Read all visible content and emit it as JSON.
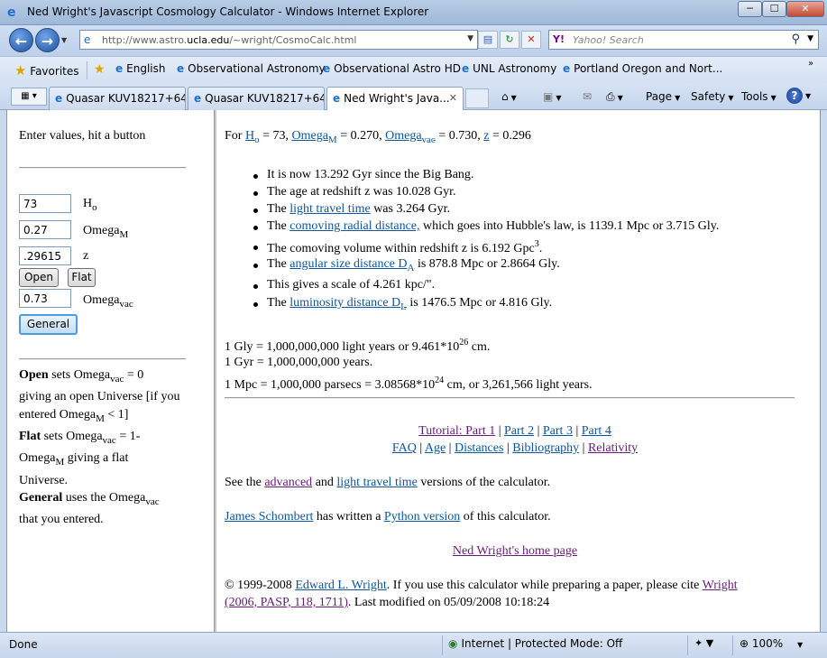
{
  "window": {
    "title": "Ned Wright's Javascript Cosmology Calculator - Windows Internet Explorer",
    "minimize": "─",
    "maximize": "☐",
    "close": "✕"
  },
  "address_bar": {
    "url_prefix": "http://www.astro.",
    "url_domain": "ucla.edu",
    "url_suffix": "/~wright/CosmoCalc.html"
  },
  "search": {
    "placeholder": "Yahoo! Search",
    "provider_icon": "Y!"
  },
  "favorites_bar": {
    "favorites_label": "Favorites",
    "items": [
      "English",
      "Observational Astronomy",
      "Observational Astro HD",
      "UNL Astronomy",
      "Portland Oregon and Nort..."
    ]
  },
  "tabs": [
    {
      "label": "Quasar KUV18217+64..."
    },
    {
      "label": "Quasar KUV18217+64..."
    },
    {
      "label": "Ned Wright's Java..."
    }
  ],
  "command_bar": {
    "page": "Page",
    "safety": "Safety",
    "tools": "Tools",
    "help": "?"
  },
  "left_frame": {
    "intro": "Enter values, hit a button",
    "inputs": {
      "h0_value": "73",
      "h0_label": "H",
      "h0_sub": "o",
      "omegam_value": "0.27",
      "omegam_label": "Omega",
      "omegam_sub": "M",
      "z_value": ".29615",
      "z_label": "z",
      "omegavac_value": "0.73",
      "omegavac_label": "Omega",
      "omegavac_sub": "vac"
    },
    "buttons": {
      "open": "Open",
      "flat": "Flat",
      "general": "General"
    },
    "help": {
      "open_bold": "Open",
      "open_t1": " sets Omega",
      "open_sub1": "vac",
      "open_t2": " = 0",
      "open_t3": "giving an open Universe [if you",
      "open_t4": "entered Omega",
      "open_sub2": "M",
      "open_t5": " < 1]",
      "flat_bold": "Flat",
      "flat_t1": " sets Omega",
      "flat_sub1": "vac",
      "flat_t2": " = 1-",
      "flat_t3": "Omega",
      "flat_sub2": "M",
      "flat_t4": " giving a flat",
      "flat_t5": "Universe.",
      "general_bold": "General",
      "general_t1": " uses the Omega",
      "general_sub": "vac",
      "general_t2": "that you entered."
    }
  },
  "right_frame": {
    "summary": {
      "for": "For ",
      "h0": "H",
      "h0_sub": "o",
      "h0_val": " = 73, ",
      "om": "Omega",
      "om_sub": "M",
      "om_val": " = 0.270, ",
      "ov": "Omega",
      "ov_sub": "vac",
      "ov_val": " = 0.730, ",
      "z": "z",
      "z_val": " = 0.296"
    },
    "results": {
      "r1": "It is now 13.292 Gyr since the Big Bang.",
      "r2": "The age at redshift z was 10.028 Gyr.",
      "r3_pre": "The ",
      "r3_link": "light travel time",
      "r3_post": " was 3.264 Gyr.",
      "r4_pre": "The ",
      "r4_link": "comoving radial distance,",
      "r4_post": " which goes into Hubble's law, is 1139.1 Mpc or 3.715 Gly.",
      "r5": "The comoving volume within redshift z is 6.192 Gpc",
      "r5_sup": "3",
      "r5_end": ".",
      "r6_pre": "The ",
      "r6_link": "angular size distance D",
      "r6_sub": "A",
      "r6_post": " is 878.8 Mpc or 2.8664 Gly.",
      "r7": "This gives a scale of 4.261 kpc/\".",
      "r8_pre": "The ",
      "r8_link": "luminosity distance D",
      "r8_sub": "L",
      "r8_post": " is 1476.5 Mpc or 4.816 Gly."
    },
    "units": {
      "u1": "1 Gly = 1,000,000,000 light years or 9.461*10",
      "u1_sup": "26",
      "u1_end": " cm.",
      "u2": "1 Gyr = 1,000,000,000 years.",
      "u3": "1 Mpc = 1,000,000 parsecs = 3.08568*10",
      "u3_sup": "24",
      "u3_end": " cm, or 3,261,566 light years."
    },
    "nav_links": {
      "tutorial1": "Tutorial: Part 1",
      "part2": "Part 2",
      "part3": "Part 3",
      "part4": "Part 4",
      "faq": "FAQ",
      "age": "Age",
      "distances": "Distances",
      "bibliography": "Bibliography",
      "relativity": "Relativity",
      "sep": " | "
    },
    "versions": {
      "pre": "See the ",
      "advanced": "advanced",
      "and": " and ",
      "ltt": "light travel time",
      "post": " versions of the calculator."
    },
    "python": {
      "author": "James Schombert",
      "mid": " has written a ",
      "link": "Python version",
      "post": " of this calculator."
    },
    "home": "Ned Wright's home page",
    "footer": {
      "pre": "© 1999-2008 ",
      "author": "Edward L. Wright",
      "mid": ". If you use this calculator while preparing a paper, please cite ",
      "cite1": "Wright",
      "cite2": "(2006, PASP, 118, 1711)",
      "post": ". Last modified on 05/09/2008 10:18:24"
    }
  },
  "status_bar": {
    "status": "Done",
    "zone": "Internet | Protected Mode: Off",
    "zoom": "100%"
  }
}
